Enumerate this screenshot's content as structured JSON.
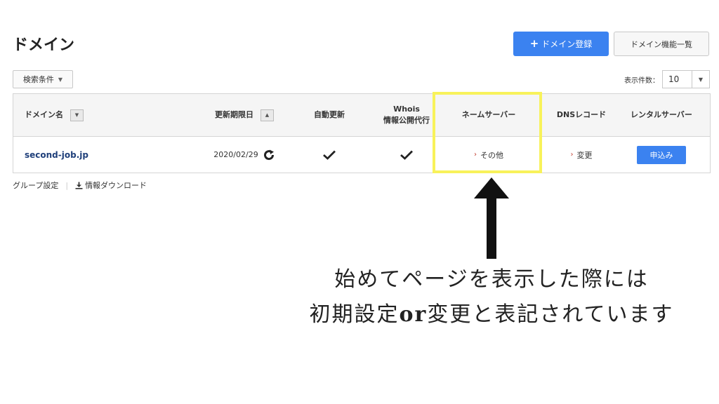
{
  "header": {
    "title": "ドメイン",
    "register_button": {
      "icon": "plus-icon",
      "label": "ドメイン登録"
    },
    "features_button": "ドメイン機能一覧"
  },
  "toolbar": {
    "filter_label": "検索条件",
    "per_page_label": "表示件数：",
    "per_page_value": "10"
  },
  "table": {
    "columns": {
      "domain": "ドメイン名",
      "expiry": "更新期限日",
      "auto_renew": "自動更新",
      "whois_line1": "Whois",
      "whois_line2": "情報公開代行",
      "nameserver": "ネームサーバー",
      "dns": "DNSレコード",
      "rental": "レンタルサーバー"
    },
    "rows": [
      {
        "domain": "second-job.jp",
        "expiry": "2020/02/29",
        "auto_renew": true,
        "whois": true,
        "nameserver": "その他",
        "dns": "変更",
        "rental": "申込み"
      }
    ]
  },
  "footer": {
    "group_settings": "グループ設定",
    "download": "情報ダウンロード"
  },
  "annotation": {
    "line1": "始めてページを表示した際には",
    "line2_a": "初期設定",
    "line2_b": "or",
    "line2_c": "変更と表記されています"
  },
  "colors": {
    "primary": "#3b82f0",
    "highlight": "#f8f25a",
    "link": "#1f3f7a",
    "arrow_mark": "#c0392b"
  }
}
